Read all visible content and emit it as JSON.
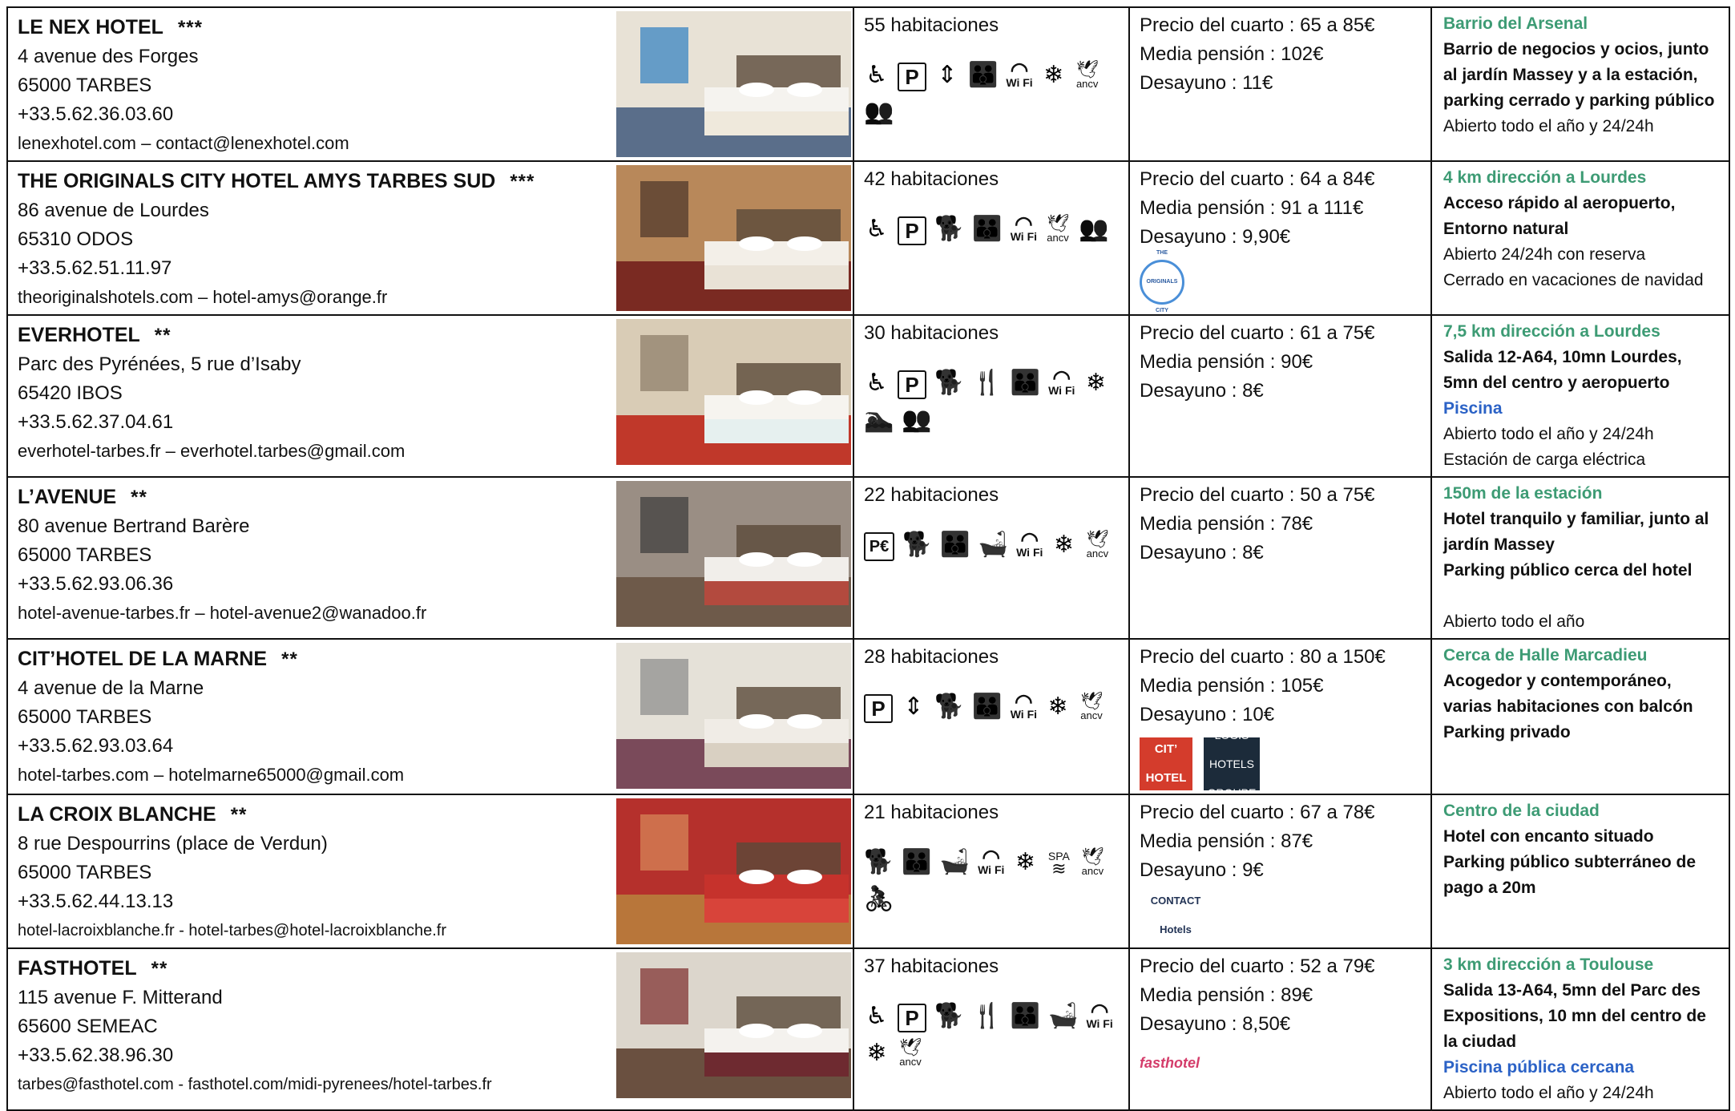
{
  "hotels": [
    {
      "name": "LE NEX HOTEL",
      "stars": "***",
      "address": "4 avenue des Forges",
      "city": "65000 TARBES",
      "phone": "+33.5.62.36.03.60",
      "contact": "lenexhotel.com – contact@lenexhotel.com",
      "rooms": "55 habitaciones",
      "room_price": "Precio del cuarto : 65 a 85€",
      "half_board": "Media pensión : 102€",
      "breakfast": "Desayuno : 11€",
      "location": "Barrio del Arsenal",
      "desc_bold": [
        "Barrio de negocios y ocios, junto al jardín Massey y a la estación, parking cerrado y parking público"
      ],
      "desc_extra": [
        "Abierto todo el año y 24/24h"
      ]
    },
    {
      "name": "THE ORIGINALS CITY HOTEL AMYS TARBES SUD",
      "stars": "***",
      "address": "86 avenue de Lourdes",
      "city": "65310 ODOS",
      "phone": "+33.5.62.51.11.97",
      "contact": "theoriginalshotels.com – hotel-amys@orange.fr",
      "rooms": "42 habitaciones",
      "room_price": "Precio del cuarto : 64 a 84€",
      "half_board": "Media pensión : 91 a 111€",
      "breakfast": "Desayuno : 9,90€",
      "brand_logos": [
        "THE ORIGINALS CITY"
      ],
      "location": "4 km dirección a Lourdes",
      "desc_bold": [
        "Acceso rápido al aeropuerto,",
        "Entorno natural"
      ],
      "desc_extra": [
        "Abierto 24/24h con reserva",
        "Cerrado en vacaciones de navidad"
      ]
    },
    {
      "name": "EVERHOTEL",
      "stars": "**",
      "address": "Parc des Pyrénées, 5 rue d’Isaby",
      "city": "65420 IBOS",
      "phone": "+33.5.62.37.04.61",
      "contact": "everhotel-tarbes.fr – everhotel.tarbes@gmail.com",
      "rooms": "30 habitaciones",
      "room_price": "Precio del cuarto : 61 a 75€",
      "half_board": "Media pensión : 90€",
      "breakfast": "Desayuno : 8€",
      "location": "7,5 km dirección a Lourdes",
      "desc_bold": [
        "Salida 12-A64, 10mn Lourdes, 5mn del centro y aeropuerto"
      ],
      "highlight": "Piscina",
      "desc_extra": [
        "Abierto todo el año y 24/24h",
        "Estación de carga eléctrica"
      ]
    },
    {
      "name": "L’AVENUE",
      "stars": "**",
      "address": "80 avenue Bertrand Barère",
      "city": "65000 TARBES",
      "phone": "+33.5.62.93.06.36",
      "contact": "hotel-avenue-tarbes.fr – hotel-avenue2@wanadoo.fr",
      "rooms": "22 habitaciones",
      "room_price": "Precio del cuarto : 50 a 75€",
      "half_board": "Media pensión : 78€",
      "breakfast": "Desayuno : 8€",
      "location": "150m de la estación",
      "desc_bold": [
        "Hotel tranquilo y familiar, junto al jardín Massey",
        "Parking público cerca del hotel"
      ],
      "desc_extra_gap": true,
      "desc_extra": [
        "Abierto todo el año"
      ]
    },
    {
      "name": "CIT’HOTEL DE LA MARNE",
      "stars": "**",
      "address": "4 avenue de la Marne",
      "city": "65000 TARBES",
      "phone": "+33.5.62.93.03.64",
      "contact": "hotel-tarbes.com – hotelmarne65000@gmail.com",
      "rooms": "28 habitaciones",
      "room_price": "Precio del cuarto : 80 a 150€",
      "half_board": "Media pensión : 105€",
      "breakfast": "Desayuno : 10€",
      "brand_logos": [
        "CIT’ HOTEL",
        "LOGIS HOTELS GROUPE"
      ],
      "location": "Cerca de Halle Marcadieu",
      "desc_bold": [
        "Acogedor y contemporáneo, varias habitaciones con balcón",
        "Parking privado"
      ],
      "desc_extra": []
    },
    {
      "name": "LA CROIX BLANCHE",
      "stars": "**",
      "address": "8 rue Despourrins (place de Verdun)",
      "city": "65000 TARBES",
      "phone": "+33.5.62.44.13.13",
      "contact": "hotel-lacroixblanche.fr - hotel-tarbes@hotel-lacroixblanche.fr",
      "rooms": "21 habitaciones",
      "room_price": "Precio del cuarto : 67 a 78€",
      "half_board": "Media pensión : 87€",
      "breakfast": "Desayuno : 9€",
      "brand_logos": [
        "CONTACT Hotels"
      ],
      "location": "Centro de la ciudad",
      "desc_bold": [
        "Hotel con encanto situado",
        "Parking público subterráneo de pago a 20m"
      ],
      "desc_extra": []
    },
    {
      "name": "FASTHOTEL",
      "stars": "**",
      "address": "115 avenue F. Mitterand",
      "city": "65600 SEMEAC",
      "phone": "+33.5.62.38.96.30",
      "contact": "tarbes@fasthotel.com - fasthotel.com/midi-pyrenees/hotel-tarbes.fr",
      "rooms": "37 habitaciones",
      "room_price": "Precio del cuarto : 52 a 79€",
      "half_board": "Media pensión : 89€",
      "breakfast": "Desayuno : 8,50€",
      "brand_logos": [
        "fasthotel"
      ],
      "location": "3 km dirección a Toulouse",
      "desc_bold": [
        "Salida 13-A64, 5mn del Parc des Expositions, 10 mn del centro de la ciudad"
      ],
      "highlight": "Piscina pública cercana",
      "desc_extra": [
        "Abierto todo el año y 24/24h"
      ]
    }
  ],
  "icon_labels": {
    "parking": "P",
    "parking_paid": "P€",
    "wifi": "Wi Fi",
    "ancv": "ancv",
    "spa": "SPA"
  },
  "colors": {
    "location": "#3d9b74",
    "highlight": "#2b62c6"
  }
}
